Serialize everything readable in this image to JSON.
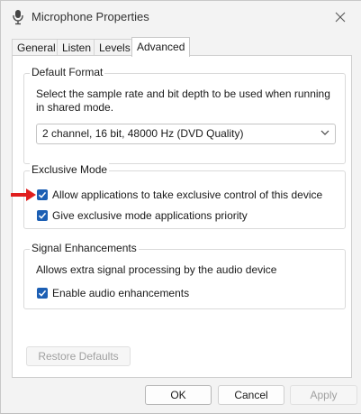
{
  "window": {
    "title": "Microphone Properties"
  },
  "tabs": [
    {
      "label": "General"
    },
    {
      "label": "Listen"
    },
    {
      "label": "Levels"
    },
    {
      "label": "Advanced"
    }
  ],
  "default_format": {
    "legend": "Default Format",
    "description_line1": "Select the sample rate and bit depth to be used when running",
    "description_line2": "in shared mode.",
    "selected": "2 channel, 16 bit, 48000 Hz (DVD Quality)"
  },
  "exclusive_mode": {
    "legend": "Exclusive Mode",
    "allow_label": "Allow applications to take exclusive control of this device",
    "allow_checked": true,
    "priority_label": "Give exclusive mode applications priority",
    "priority_checked": true
  },
  "signal_enhancements": {
    "legend": "Signal Enhancements",
    "description": "Allows extra signal processing by the audio device",
    "enable_label": "Enable audio enhancements",
    "enable_checked": true
  },
  "buttons": {
    "restore_defaults": "Restore Defaults",
    "ok": "OK",
    "cancel": "Cancel",
    "apply": "Apply"
  },
  "colors": {
    "checkbox": "#1c5fb4",
    "annotation_arrow": "#e01e1e"
  },
  "icons": {
    "title": "microphone-icon",
    "close": "close-icon",
    "dropdown": "chevron-down-icon",
    "check": "checkmark-icon",
    "annotation": "red-arrow-icon"
  }
}
